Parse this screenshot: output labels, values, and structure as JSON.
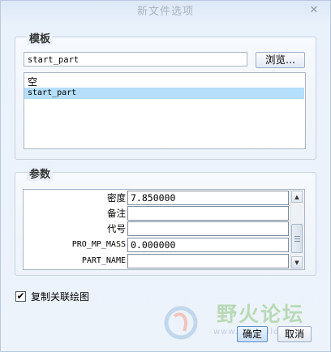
{
  "window": {
    "title": "新文件选项",
    "close_glyph": "✕"
  },
  "template_group": {
    "title": "模板",
    "input_value": "start_part",
    "browse_label": "浏览...",
    "list_items": [
      {
        "label": "空",
        "selected": false
      },
      {
        "label": "start_part",
        "selected": true
      }
    ]
  },
  "parameters_group": {
    "title": "参数",
    "rows": [
      {
        "label": "密度",
        "value": "7.850000"
      },
      {
        "label": "备注",
        "value": ""
      },
      {
        "label": "代号",
        "value": ""
      },
      {
        "label": "PRO_MP_MASS",
        "value": "0.000000"
      },
      {
        "label": "PART_NAME",
        "value": ""
      }
    ]
  },
  "copy_relations": {
    "label": "复制关联绘图",
    "checked": true
  },
  "buttons": {
    "ok_label": "确定",
    "cancel_label": "取消"
  },
  "watermark": {
    "text": "野火论坛",
    "url": "www.proewildfire.cn"
  },
  "icons": {
    "scroll_up": "triangle-up-icon",
    "scroll_down": "triangle-down-icon",
    "check": "checkmark-icon"
  }
}
